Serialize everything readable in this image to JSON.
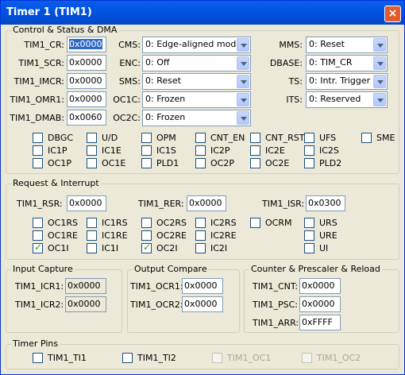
{
  "title": "Timer 1 (TIM1)",
  "close_glyph": "×",
  "control": {
    "legend": "Control & Status & DMA",
    "regs": [
      {
        "label": "TIM1_CR:",
        "value": "0x0000"
      },
      {
        "label": "TIM1_SCR:",
        "value": "0x0000"
      },
      {
        "label": "TIM1_IMCR:",
        "value": "0x0000"
      },
      {
        "label": "TIM1_OMR1:",
        "value": "0x0000"
      },
      {
        "label": "TIM1_DMAB:",
        "value": "0x0060"
      }
    ],
    "mid": [
      {
        "label": "CMS:",
        "value": "0: Edge-aligned mode"
      },
      {
        "label": "ENC:",
        "value": "0: Off"
      },
      {
        "label": "SMS:",
        "value": "0: Reset"
      },
      {
        "label": "OC1C:",
        "value": "0: Frozen"
      },
      {
        "label": "OC2C:",
        "value": "0: Frozen"
      }
    ],
    "right": [
      {
        "label": "MMS:",
        "value": "0: Reset"
      },
      {
        "label": "DBASE:",
        "value": "0: TIM_CR"
      },
      {
        "label": "TS:",
        "value": "0: Intr. Trigger"
      },
      {
        "label": "ITS:",
        "value": "0: Reserved"
      }
    ],
    "checks": [
      "DBGC",
      "U/D",
      "OPM",
      "CNT_EN",
      "CNT_RST",
      "UFS",
      "SME",
      "IC1P",
      "IC1E",
      "IC1S",
      "IC2P",
      "IC2E",
      "IC2S",
      "OC1P",
      "OC1E",
      "PLD1",
      "OC2P",
      "OC2E",
      "PLD2"
    ]
  },
  "request": {
    "legend": "Request & Interrupt",
    "rsr_label": "TIM1_RSR:",
    "rsr_value": "0x0000",
    "rer_label": "TIM1_RER:",
    "rer_value": "0x0000",
    "isr_label": "TIM1_ISR:",
    "isr_value": "0x0300",
    "checks": [
      {
        "label": "OC1RS",
        "checked": false
      },
      {
        "label": "IC1RS",
        "checked": false
      },
      {
        "label": "OC2RS",
        "checked": false
      },
      {
        "label": "IC2RS",
        "checked": false
      },
      {
        "label": "OCRM",
        "checked": false
      },
      {
        "label": "URS",
        "checked": false
      },
      {
        "label": "OC1RE",
        "checked": false
      },
      {
        "label": "IC1RE",
        "checked": false
      },
      {
        "label": "OC2RE",
        "checked": false
      },
      {
        "label": "IC2RE",
        "checked": false
      },
      {
        "label": "URE",
        "checked": false
      },
      {
        "label": "OC1I",
        "checked": true
      },
      {
        "label": "IC1I",
        "checked": false
      },
      {
        "label": "OC2I",
        "checked": true
      },
      {
        "label": "IC2I",
        "checked": false
      },
      {
        "label": "UI",
        "checked": false
      }
    ]
  },
  "input_capture": {
    "legend": "Input Capture",
    "icr1_label": "TIM1_ICR1:",
    "icr1_value": "0x0000",
    "icr2_label": "TIM1_ICR2:",
    "icr2_value": "0x0000"
  },
  "output_compare": {
    "legend": "Output Compare",
    "ocr1_label": "TIM1_OCR1:",
    "ocr1_value": "0x0000",
    "ocr2_label": "TIM1_OCR2:",
    "ocr2_value": "0x0000"
  },
  "counter": {
    "legend": "Counter & Prescaler & Reload",
    "cnt_label": "TIM1_CNT:",
    "cnt_value": "0x0000",
    "psc_label": "TIM1_PSC:",
    "psc_value": "0x0000",
    "arr_label": "TIM1_ARR:",
    "arr_value": "0xFFFF"
  },
  "pins": {
    "legend": "Timer Pins",
    "items": [
      {
        "label": "TIM1_TI1",
        "enabled": true
      },
      {
        "label": "TIM1_TI2",
        "enabled": true
      },
      {
        "label": "TIM1_OC1",
        "enabled": false
      },
      {
        "label": "TIM1_OC2",
        "enabled": false
      }
    ]
  }
}
